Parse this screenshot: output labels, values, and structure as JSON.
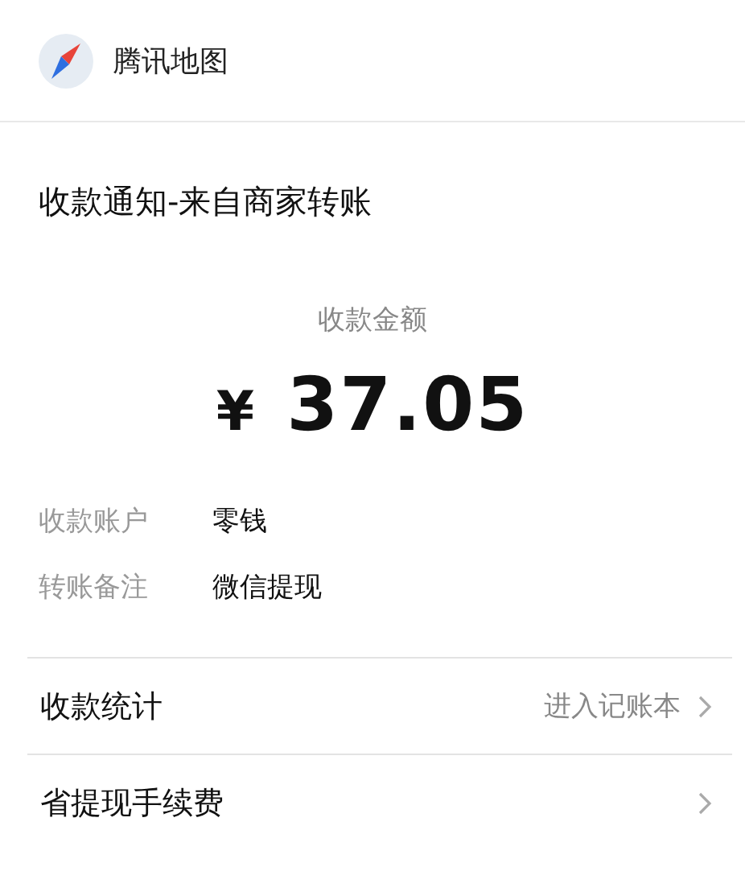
{
  "header": {
    "app_name": "腾讯地图"
  },
  "notice": {
    "title": "收款通知-来自商家转账",
    "amount_label": "收款金额",
    "currency": "¥",
    "amount": "37.05"
  },
  "details": [
    {
      "label": "收款账户",
      "value": "零钱"
    },
    {
      "label": "转账备注",
      "value": "微信提现"
    }
  ],
  "links": [
    {
      "label": "收款统计",
      "hint": "进入记账本"
    },
    {
      "label": "省提现手续费"
    }
  ]
}
